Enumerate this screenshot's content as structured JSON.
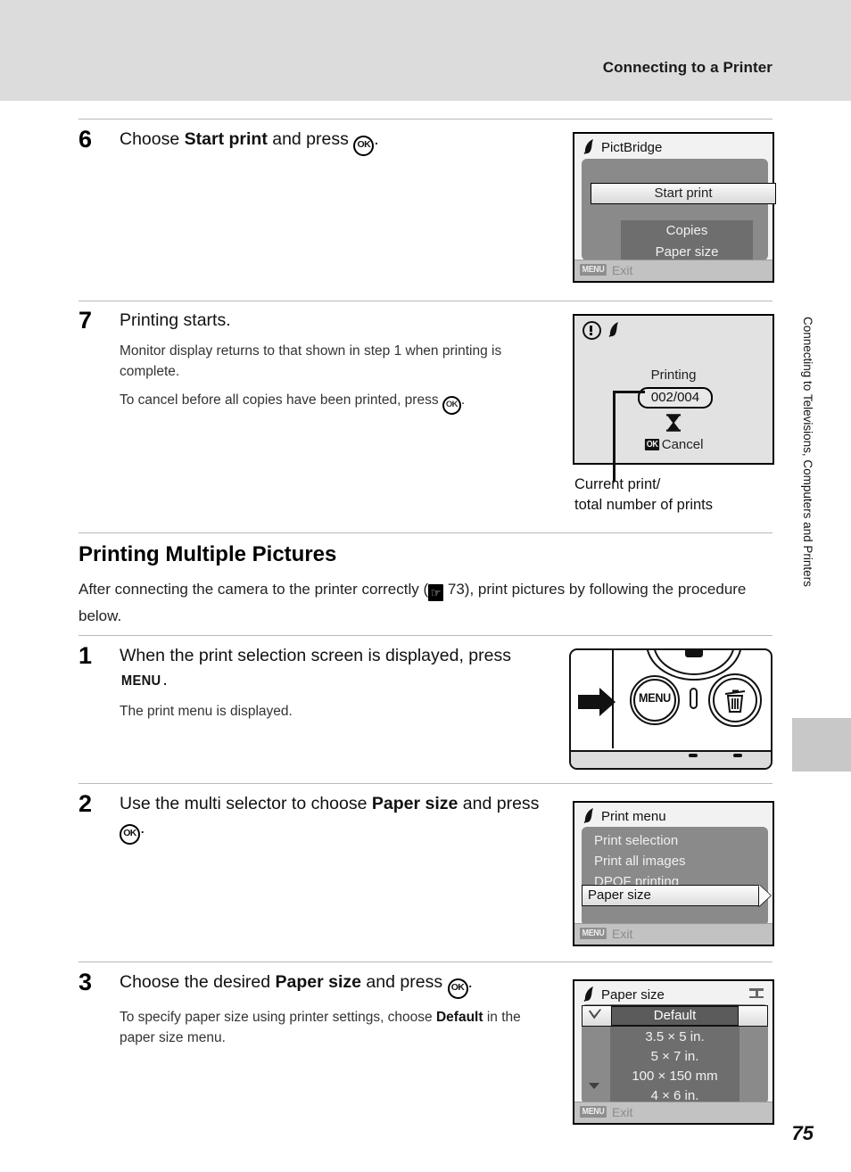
{
  "header": {
    "title": "Connecting to a Printer"
  },
  "side_tab": {
    "text": "Connecting to Televisions, Computers and Printers"
  },
  "page_number": "75",
  "steps": [
    {
      "num": "6",
      "title_pre": "Choose ",
      "title_bold": "Start print",
      "title_post": " and press ",
      "title_end": "."
    },
    {
      "num": "7",
      "title": "Printing starts.",
      "sub1": "Monitor display returns to that shown in step 1 when printing is complete.",
      "sub2_pre": "To cancel before all copies have been printed, press ",
      "sub2_post": "."
    },
    {
      "num": "1",
      "title_pre": "When the print selection screen is displayed, press ",
      "title_menu": "MENU",
      "title_post": ".",
      "sub1": "The print menu is displayed."
    },
    {
      "num": "2",
      "title_pre": "Use the multi selector to choose ",
      "title_bold": "Paper size",
      "title_post": " and press ",
      "title_end": "."
    },
    {
      "num": "3",
      "title_pre": "Choose the desired ",
      "title_bold": "Paper size",
      "title_post": " and press ",
      "title_end": ".",
      "sub_pre": "To specify paper size using printer settings, choose ",
      "sub_bold": "Default",
      "sub_post": " in the paper size menu."
    }
  ],
  "section": {
    "heading": "Printing Multiple Pictures",
    "para_pre": "After connecting the camera to the printer correctly (",
    "para_ref": "73",
    "para_post": "), print pictures by following the procedure below."
  },
  "icons": {
    "ok": "OK",
    "menu": "MENU",
    "reference": "book-ref-icon",
    "pictbridge": "pictbridge-icon",
    "warning": "warning-icon",
    "hourglass": "⌛",
    "check": "❥",
    "scroll_down": "▼",
    "trash": "🗑"
  },
  "screens": {
    "pictbridge": {
      "title": "PictBridge",
      "start_print": "Start print",
      "copies": "Copies",
      "paper_size": "Paper size",
      "menu_badge": "MENU",
      "exit": "Exit"
    },
    "printing": {
      "label": "Printing",
      "counter": "002/004",
      "ok_badge": "OK",
      "cancel": "Cancel"
    },
    "print_menu": {
      "title": "Print menu",
      "items": [
        "Print selection",
        "Print all images",
        "DPOF printing"
      ],
      "selected": "Paper size",
      "menu_badge": "MENU",
      "exit": "Exit"
    },
    "paper_size": {
      "title": "Paper size",
      "selected": "Default",
      "items": [
        "3.5 × 5 in.",
        "5 × 7 in.",
        "100 × 150 mm",
        "4 × 6 in."
      ],
      "menu_badge": "MENU",
      "exit": "Exit"
    }
  },
  "callout": {
    "line1": "Current print/",
    "line2": "total number of prints"
  },
  "camera": {
    "menu_button": "MENU"
  },
  "colors": {
    "header_band": "#dcdcdc",
    "lcd_bg": "#f2f2f2",
    "panel_gray": "#8a8a8a",
    "panel_dark": "#6e6e6e",
    "footer_gray": "#c2c2c2"
  }
}
